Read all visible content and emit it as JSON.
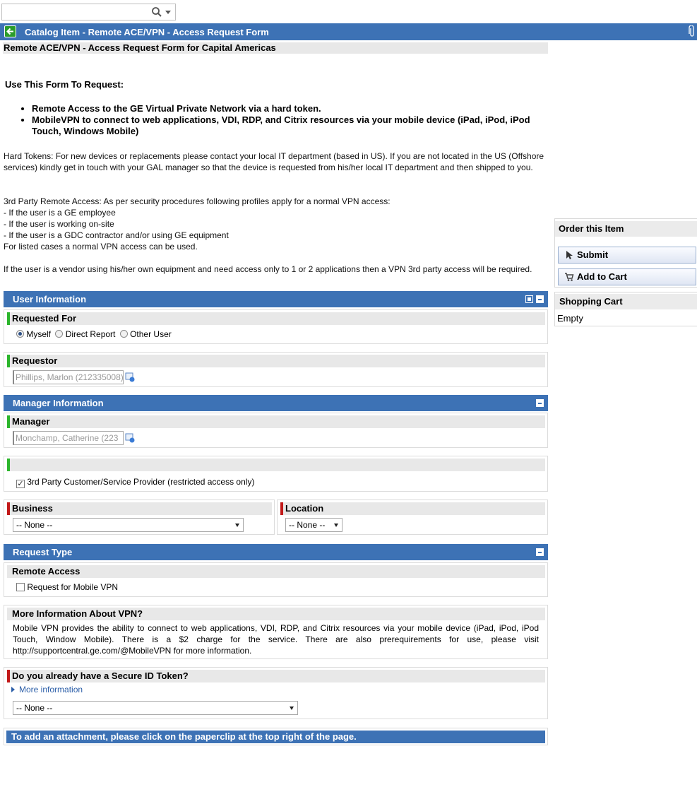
{
  "search": {
    "placeholder": "",
    "value": ""
  },
  "header": {
    "title": "Catalog Item - Remote ACE/VPN - Access Request Form",
    "subtitle": "Remote ACE/VPN - Access Request Form for Capital Americas"
  },
  "intro": {
    "heading": "Use This Form To Request:",
    "bullets": [
      "Remote Access to the GE Virtual Private Network via a hard token.",
      "MobileVPN to connect to web applications, VDI, RDP, and Citrix resources via your mobile device (iPad, iPod, iPod Touch, Windows Mobile)"
    ],
    "para1": "Hard Tokens: For new devices or replacements please contact your local IT department (based in US). If you are not located in the US (Offshore services) kindly get in touch with your GAL manager so that the device is requested from his/her local IT department and then shipped to you.",
    "para2_lines": [
      "3rd Party Remote Access: As per security procedures following profiles apply for a normal VPN access:",
      "- If the user is a GE employee",
      "- If the user is working on-site",
      "- If the user is a GDC contractor and/or using GE equipment",
      "For listed cases a normal VPN access can be used."
    ],
    "para3": "If the user is a vendor using his/her own equipment and need access only to 1 or 2 applications then a VPN 3rd party access will be required."
  },
  "sections": {
    "user_info": "User Information",
    "manager_info": "Manager Information",
    "request_type": "Request Type"
  },
  "requested_for": {
    "label": "Requested For",
    "options": [
      "Myself",
      "Direct Report",
      "Other User"
    ],
    "selected": "Myself"
  },
  "requestor": {
    "label": "Requestor",
    "value": "Phillips, Marlon (212335008)"
  },
  "manager": {
    "label": "Manager",
    "value": "Monchamp, Catherine (223"
  },
  "third_party": {
    "label": "3rd Party Customer/Service Provider (restricted access only)",
    "checked": true
  },
  "business": {
    "label": "Business",
    "value": "-- None --"
  },
  "location": {
    "label": "Location",
    "value": "-- None --"
  },
  "remote_access": {
    "label": "Remote Access",
    "checkbox_label": "Request for Mobile VPN",
    "checked": false
  },
  "vpn_info": {
    "label": "More Information About VPN?",
    "text": "Mobile VPN provides the ability to connect to web applications, VDI, RDP, and Citrix resources via your mobile device (iPad, iPod, iPod Touch, Window Mobile). There is a $2 charge for the service. There are also prerequirements for use, please visit http://supportcentral.ge.com/@MobileVPN for more information."
  },
  "secure_id": {
    "label": "Do you already have a Secure ID Token?",
    "more_link": "More information",
    "value": "-- None --"
  },
  "attachment_note": "To add an attachment, please click on the paperclip at the top right of the page.",
  "order": {
    "title": "Order this Item",
    "submit": "Submit",
    "add_to_cart": "Add to Cart"
  },
  "cart": {
    "title": "Shopping Cart",
    "status": "Empty"
  },
  "colors": {
    "header_blue": "#3d72b5",
    "mandatory_ok": "#2cb52c",
    "mandatory_missing": "#c21919",
    "link": "#2b5ea8"
  }
}
